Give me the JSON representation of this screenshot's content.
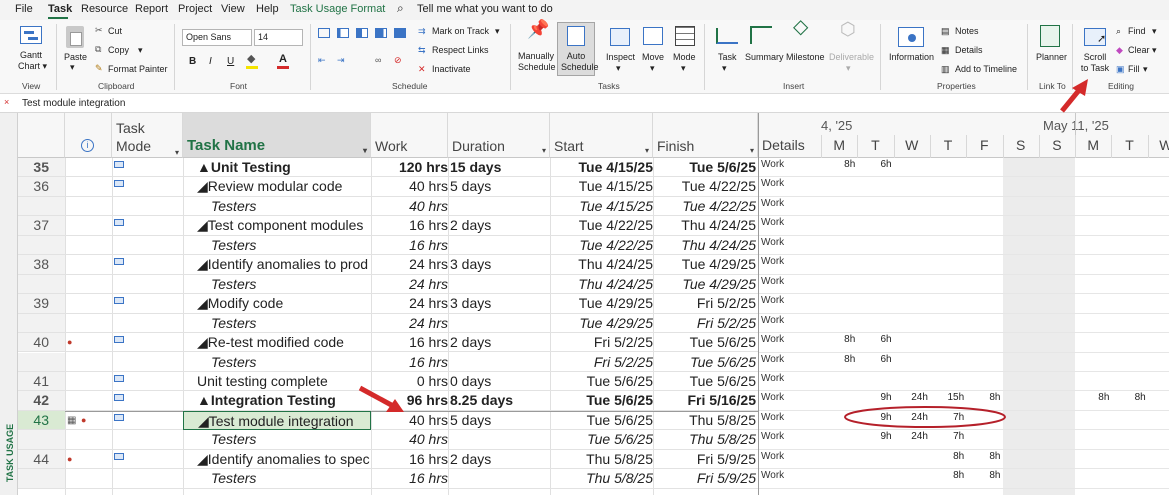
{
  "menu": {
    "items": [
      "File",
      "Task",
      "Resource",
      "Report",
      "Project",
      "View",
      "Help",
      "Task Usage Format"
    ],
    "search": "Tell me what you want to do"
  },
  "ribbon": {
    "view": {
      "gantt_line1": "Gantt",
      "gantt_line2": "Chart ▾",
      "label": "View"
    },
    "clipboard": {
      "paste": "Paste",
      "cut": "Cut",
      "copy": "Copy",
      "painter": "Format Painter",
      "label": "Clipboard"
    },
    "font": {
      "family": "Open Sans",
      "size": "14",
      "label": "Font"
    },
    "schedule": {
      "mark": "Mark on Track",
      "respect": "Respect Links",
      "inactivate": "Inactivate",
      "label": "Schedule"
    },
    "tasks": {
      "manual1": "Manually",
      "manual2": "Schedule",
      "auto1": "Auto",
      "auto2": "Schedule",
      "inspect": "Inspect",
      "move": "Move",
      "mode": "Mode",
      "label": "Tasks"
    },
    "insert": {
      "task": "Task",
      "summary": "Summary",
      "milestone": "Milestone",
      "deliverable": "Deliverable",
      "label": "Insert"
    },
    "properties": {
      "information": "Information",
      "notes": "Notes",
      "details": "Details",
      "timeline": "Add to Timeline",
      "label": "Properties"
    },
    "linkto": {
      "planner": "Planner",
      "label": "Link To"
    },
    "editing": {
      "scroll1": "Scroll",
      "scroll2": "to Task",
      "find": "Find",
      "clear": "Clear",
      "fill": "Fill",
      "label": "Editing"
    }
  },
  "entry_bar": {
    "value": "Test module integration"
  },
  "side_label": "TASK USAGE",
  "columns": {
    "mode1": "Task",
    "mode2": "Mode",
    "name": "Task Name",
    "work": "Work",
    "duration": "Duration",
    "start": "Start",
    "finish": "Finish"
  },
  "timescale": {
    "week1": "4, '25",
    "week2": "May 11, '25",
    "details": "Details",
    "days": [
      "M",
      "T",
      "W",
      "T",
      "F",
      "S",
      "S",
      "M",
      "T",
      "W"
    ]
  },
  "rows": [
    {
      "id": "35",
      "name": "▲Unit Testing",
      "work": "120 hrs",
      "duration": "15 days",
      "start": "Tue 4/15/25",
      "finish": "Tue 5/6/25",
      "detail": "Work",
      "vals": [
        "8h",
        "6h",
        "",
        "",
        "",
        "",
        "",
        "",
        "",
        ""
      ],
      "style": "summary",
      "indent": 0,
      "mode": true,
      "person": false
    },
    {
      "id": "36",
      "name": "◢Review modular code",
      "work": "40 hrs",
      "duration": "5 days",
      "start": "Tue 4/15/25",
      "finish": "Tue 4/22/25",
      "detail": "Work",
      "vals": [
        "",
        "",
        "",
        "",
        "",
        "",
        "",
        "",
        "",
        ""
      ],
      "style": "task",
      "indent": 1,
      "mode": true,
      "person": false
    },
    {
      "id": "",
      "name": "Testers",
      "work": "40 hrs",
      "duration": "",
      "start": "Tue 4/15/25",
      "finish": "Tue 4/22/25",
      "detail": "Work",
      "vals": [
        "",
        "",
        "",
        "",
        "",
        "",
        "",
        "",
        "",
        ""
      ],
      "style": "assign",
      "indent": 2,
      "mode": false,
      "person": false
    },
    {
      "id": "37",
      "name": "◢Test component modules",
      "work": "16 hrs",
      "duration": "2 days",
      "start": "Tue 4/22/25",
      "finish": "Thu 4/24/25",
      "detail": "Work",
      "vals": [
        "",
        "",
        "",
        "",
        "",
        "",
        "",
        "",
        "",
        ""
      ],
      "style": "task",
      "indent": 1,
      "mode": true,
      "person": false
    },
    {
      "id": "",
      "name": "Testers",
      "work": "16 hrs",
      "duration": "",
      "start": "Tue 4/22/25",
      "finish": "Thu 4/24/25",
      "detail": "Work",
      "vals": [
        "",
        "",
        "",
        "",
        "",
        "",
        "",
        "",
        "",
        ""
      ],
      "style": "assign",
      "indent": 2,
      "mode": false,
      "person": false
    },
    {
      "id": "38",
      "name": "◢Identify anomalies to prod",
      "work": "24 hrs",
      "duration": "3 days",
      "start": "Thu 4/24/25",
      "finish": "Tue 4/29/25",
      "detail": "Work",
      "vals": [
        "",
        "",
        "",
        "",
        "",
        "",
        "",
        "",
        "",
        ""
      ],
      "style": "task",
      "indent": 1,
      "mode": true,
      "person": false
    },
    {
      "id": "",
      "name": "Testers",
      "work": "24 hrs",
      "duration": "",
      "start": "Thu 4/24/25",
      "finish": "Tue 4/29/25",
      "detail": "Work",
      "vals": [
        "",
        "",
        "",
        "",
        "",
        "",
        "",
        "",
        "",
        ""
      ],
      "style": "assign",
      "indent": 2,
      "mode": false,
      "person": false
    },
    {
      "id": "39",
      "name": "◢Modify code",
      "work": "24 hrs",
      "duration": "3 days",
      "start": "Tue 4/29/25",
      "finish": "Fri 5/2/25",
      "detail": "Work",
      "vals": [
        "",
        "",
        "",
        "",
        "",
        "",
        "",
        "",
        "",
        ""
      ],
      "style": "task",
      "indent": 1,
      "mode": true,
      "person": false
    },
    {
      "id": "",
      "name": "Testers",
      "work": "24 hrs",
      "duration": "",
      "start": "Tue 4/29/25",
      "finish": "Fri 5/2/25",
      "detail": "Work",
      "vals": [
        "",
        "",
        "",
        "",
        "",
        "",
        "",
        "",
        "",
        ""
      ],
      "style": "assign",
      "indent": 2,
      "mode": false,
      "person": false
    },
    {
      "id": "40",
      "name": "◢Re-test modified code",
      "work": "16 hrs",
      "duration": "2 days",
      "start": "Fri 5/2/25",
      "finish": "Tue 5/6/25",
      "detail": "Work",
      "vals": [
        "8h",
        "6h",
        "",
        "",
        "",
        "",
        "",
        "",
        "",
        ""
      ],
      "style": "task",
      "indent": 1,
      "mode": true,
      "person": true
    },
    {
      "id": "",
      "name": "Testers",
      "work": "16 hrs",
      "duration": "",
      "start": "Fri 5/2/25",
      "finish": "Tue 5/6/25",
      "detail": "Work",
      "vals": [
        "8h",
        "6h",
        "",
        "",
        "",
        "",
        "",
        "",
        "",
        ""
      ],
      "style": "assign",
      "indent": 2,
      "mode": false,
      "person": false
    },
    {
      "id": "41",
      "name": "Unit testing complete",
      "work": "0 hrs",
      "duration": "0 days",
      "start": "Tue 5/6/25",
      "finish": "Tue 5/6/25",
      "detail": "Work",
      "vals": [
        "",
        "",
        "",
        "",
        "",
        "",
        "",
        "",
        "",
        ""
      ],
      "style": "task",
      "indent": 1,
      "mode": true,
      "person": false
    },
    {
      "id": "42",
      "name": "▲Integration Testing",
      "work": "96 hrs",
      "duration": "8.25 days",
      "start": "Tue 5/6/25",
      "finish": "Fri 5/16/25",
      "detail": "Work",
      "vals": [
        "",
        "9h",
        "24h",
        "15h",
        "8h",
        "",
        "",
        "8h",
        "8h",
        ""
      ],
      "style": "summary",
      "indent": 0,
      "mode": true,
      "person": false
    },
    {
      "id": "43",
      "name": "◢Test module integration",
      "work": "40 hrs",
      "duration": "5 days",
      "start": "Tue 5/6/25",
      "finish": "Thu 5/8/25",
      "detail": "Work",
      "vals": [
        "",
        "9h",
        "24h",
        "7h",
        "",
        "",
        "",
        "",
        "",
        ""
      ],
      "style": "task",
      "indent": 1,
      "mode": true,
      "person": true,
      "selected": true
    },
    {
      "id": "",
      "name": "Testers",
      "work": "40 hrs",
      "duration": "",
      "start": "Tue 5/6/25",
      "finish": "Thu 5/8/25",
      "detail": "Work",
      "vals": [
        "",
        "9h",
        "24h",
        "7h",
        "",
        "",
        "",
        "",
        "",
        ""
      ],
      "style": "assign",
      "indent": 2,
      "mode": false,
      "person": false
    },
    {
      "id": "44",
      "name": "◢Identify anomalies to spec",
      "work": "16 hrs",
      "duration": "2 days",
      "start": "Thu 5/8/25",
      "finish": "Fri 5/9/25",
      "detail": "Work",
      "vals": [
        "",
        "",
        "",
        "8h",
        "8h",
        "",
        "",
        "",
        "",
        ""
      ],
      "style": "task",
      "indent": 1,
      "mode": true,
      "person": true
    },
    {
      "id": "",
      "name": "Testers",
      "work": "16 hrs",
      "duration": "",
      "start": "Thu 5/8/25",
      "finish": "Fri 5/9/25",
      "detail": "Work",
      "vals": [
        "",
        "",
        "",
        "8h",
        "8h",
        "",
        "",
        "",
        "",
        ""
      ],
      "style": "assign",
      "indent": 2,
      "mode": false,
      "person": false
    }
  ],
  "colors": {
    "accent": "#217346",
    "arrow": "#d42a2a",
    "selected": "#d9ead3"
  }
}
